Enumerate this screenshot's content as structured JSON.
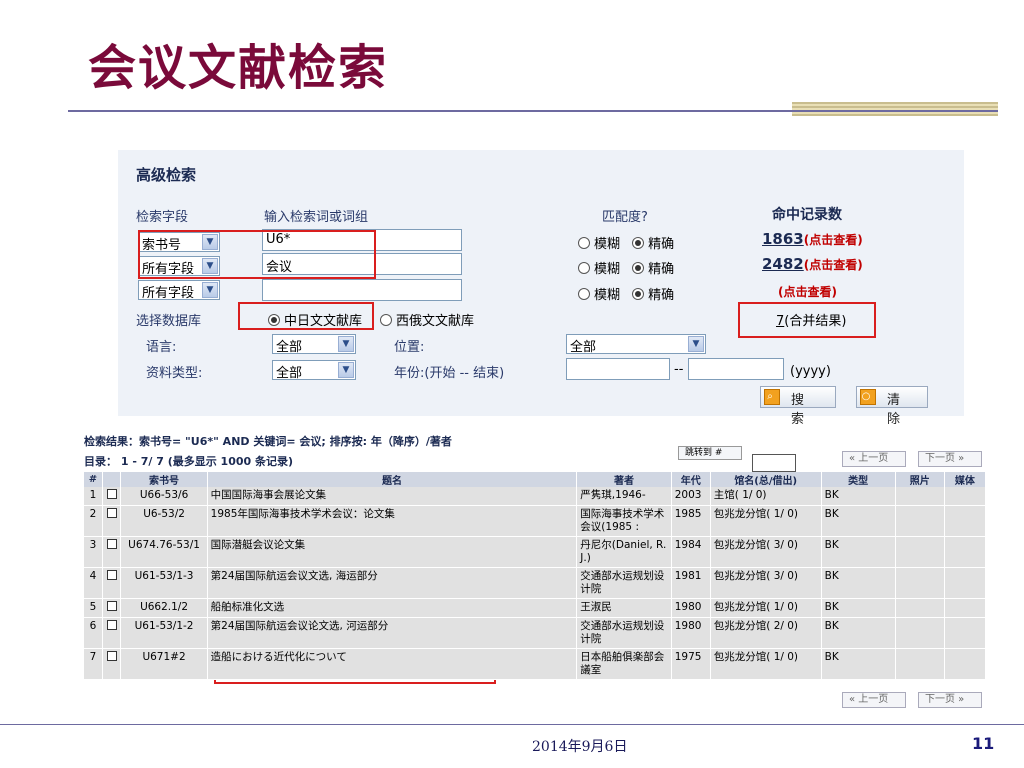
{
  "slide": {
    "title": "会议文献检索",
    "footer_date": "2014年9月6日",
    "page_number": "11"
  },
  "search": {
    "title": "高级检索",
    "col_field": "检索字段",
    "col_term": "输入检索词或词组",
    "col_match": "匹配度?",
    "col_hits": "命中记录数",
    "rows": [
      {
        "field": "索书号",
        "term": "U6*",
        "fuzzy": "模糊",
        "exact": "精确",
        "hits": "1863",
        "view": "(点击查看)"
      },
      {
        "field": "所有字段",
        "term": "会议",
        "fuzzy": "模糊",
        "exact": "精确",
        "hits": "2482",
        "view": "(点击查看)"
      },
      {
        "field": "所有字段",
        "term": "",
        "fuzzy": "模糊",
        "exact": "精确",
        "hits": "",
        "view": "(点击查看)"
      }
    ],
    "db_label": "选择数据库",
    "db_option1": "中日文文献库",
    "db_option2": "西俄文文献库",
    "merged_count": "7",
    "merged_label": "(合并结果)",
    "lang_label": "语言:",
    "lang_value": "全部",
    "loc_label": "位置:",
    "loc_value": "全部",
    "type_label": "资料类型:",
    "type_value": "全部",
    "year_label": "年份:(开始 -- 结束)",
    "year_sep": "--",
    "year_format": "(yyyy)",
    "search_button": "搜 索",
    "clear_button": "清 除"
  },
  "results": {
    "summary": "检索结果：索书号= \"U6*\" AND 关键词= 会议; 排序按: 年（降序）/著者",
    "catalog": "目录： 1 - 7/ 7 (最多显示 1000 条记录)",
    "jump_label": "跳转到 #",
    "prev_label": "上一页",
    "next_label": "下一页",
    "headers": [
      "#",
      "",
      "索书号",
      "题名",
      "著者",
      "年代",
      "馆名(总/借出)",
      "类型",
      "照片",
      "媒体"
    ],
    "rows": [
      {
        "n": "1",
        "call": "U66-53/6",
        "title": "中国国际海事会展论文集",
        "author": "严隽琪,1946-",
        "year": "2003",
        "lib": "主馆( 1/ 0)",
        "type": "BK"
      },
      {
        "n": "2",
        "call": "U6-53/2",
        "title": "1985年国际海事技术学术会议：论文集",
        "author": "国际海事技术学术会议(1985 :",
        "year": "1985",
        "lib": "包兆龙分馆( 1/ 0)",
        "type": "BK"
      },
      {
        "n": "3",
        "call": "U674.76-53/1",
        "title": "国际潜艇会议论文集",
        "author": "丹尼尔(Daniel, R. J.)",
        "year": "1984",
        "lib": "包兆龙分馆( 3/ 0)",
        "type": "BK"
      },
      {
        "n": "4",
        "call": "U61-53/1-3",
        "title": "第24届国际航运会议文选, 海运部分",
        "author": "交通部水运规划设计院",
        "year": "1981",
        "lib": "包兆龙分馆( 3/ 0)",
        "type": "BK"
      },
      {
        "n": "5",
        "call": "U662.1/2",
        "title": "船舶标准化文选",
        "author": "王淑民",
        "year": "1980",
        "lib": "包兆龙分馆( 1/ 0)",
        "type": "BK"
      },
      {
        "n": "6",
        "call": "U61-53/1-2",
        "title": "第24届国际航运会议论文选, 河运部分",
        "author": "交通部水运规划设计院",
        "year": "1980",
        "lib": "包兆龙分馆( 2/ 0)",
        "type": "BK"
      },
      {
        "n": "7",
        "call": "U671#2",
        "title": "造船における近代化について",
        "author": "日本船舶俱楽部会議室",
        "year": "1975",
        "lib": "包兆龙分馆( 1/ 0)",
        "type": "BK"
      }
    ]
  }
}
